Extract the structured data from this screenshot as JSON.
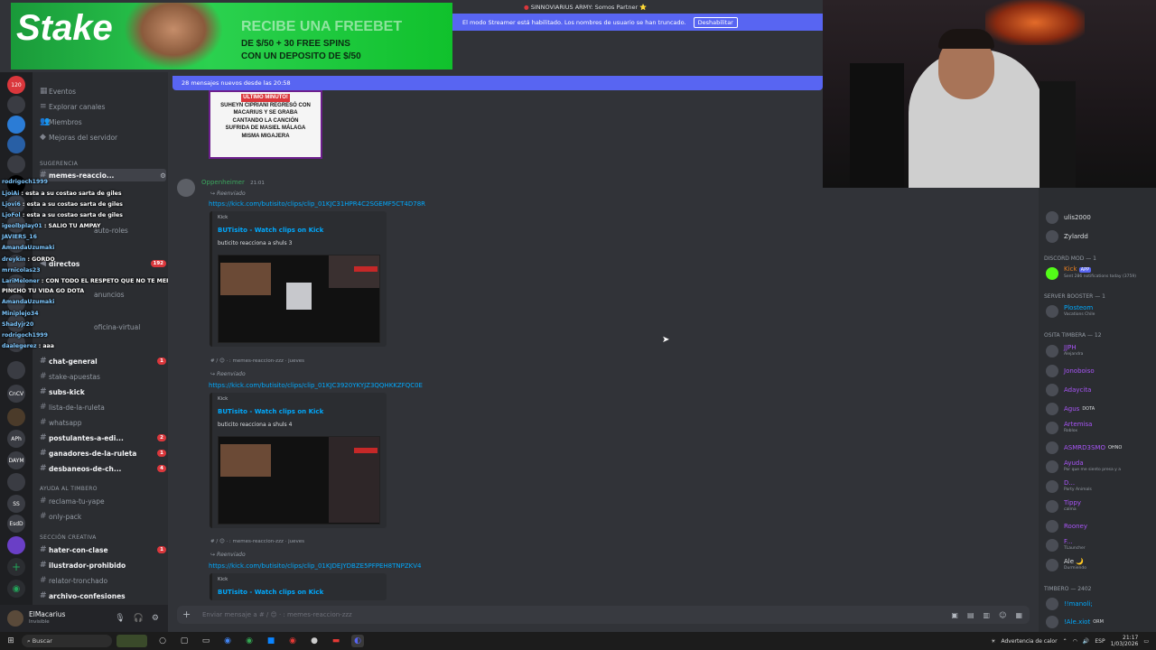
{
  "ad": {
    "logo": "Stake",
    "line1": "RECIBE UNA FREEBET",
    "line2": "DE $/50 + 30 FREE SPINS",
    "line3": "CON UN DEPOSITO DE $/50"
  },
  "top_title": "SINNOVIARIUS ARMY: Somos Partner ⭐",
  "streamer_banner": {
    "text": "El modo Streamer está habilitado. Los nombres de usuario se han truncado.",
    "button": "Deshabilitar"
  },
  "new_messages": "28 mensajes nuevos desde las 20:58",
  "sidebar": {
    "nav": [
      {
        "label": "Eventos"
      },
      {
        "label": "Explorar canales"
      },
      {
        "label": "Miembros"
      },
      {
        "label": "Mejoras del servidor"
      }
    ],
    "cat_sugerencia": "Sugerencia",
    "channels": [
      {
        "label": "memes-reaccio...",
        "unread": true
      },
      {
        "label": "directos",
        "unread": true,
        "badge": "192"
      },
      {
        "label": "auto-roles",
        "unread": false
      },
      {
        "label": "anuncios",
        "unread": false
      },
      {
        "label": "oficina-virtual",
        "unread": false
      },
      {
        "label": "chat-general",
        "unread": true,
        "badge": "1"
      },
      {
        "label": "stake-apuestas",
        "unread": false
      },
      {
        "label": "subs-kick",
        "unread": true
      },
      {
        "label": "lista-de-la-ruleta",
        "unread": false
      },
      {
        "label": "whatsapp",
        "unread": false
      },
      {
        "label": "postulantes-a-edi...",
        "unread": true,
        "badge": "2"
      },
      {
        "label": "ganadores-de-la-ruleta",
        "unread": true,
        "badge": "1"
      },
      {
        "label": "desbaneos-de-ch...",
        "unread": true,
        "badge": "4"
      },
      {
        "label": "reclama-tu-yape",
        "unread": false
      },
      {
        "label": "only-pack",
        "unread": false
      },
      {
        "label": "hater-con-clase",
        "unread": true,
        "badge": "1"
      },
      {
        "label": "ilustrador-prohibido",
        "unread": true
      },
      {
        "label": "relator-tronchado",
        "unread": false
      },
      {
        "label": "archivo-confesiones",
        "unread": true
      }
    ],
    "cat_ayuda": "AYUDA AL TIMBERO",
    "cat_creativa": "SECCIÓN CREATIVA"
  },
  "user": {
    "name": "ElMacarius",
    "status": "Invisible"
  },
  "image_caption": [
    "ÚLTIMO MINUTO!",
    "SUHEYN CIPRIANI REGRESÓ CON",
    "MACARIUS Y SE GRABA",
    "CANTANDO LA CANCIÓN",
    "SUFRIDA DE MASIEL MÁLAGA",
    "MISMA MIGAJERA"
  ],
  "message": {
    "author": "Oppenheimer",
    "time": "21:01"
  },
  "forwards": [
    {
      "label": "Reenviado",
      "url": "https://kick.com/butisito/clips/clip_01KJC31HPR4C2SGEMF5CT4D78R",
      "provider": "Kick",
      "title": "BUTisito - Watch clips on Kick",
      "desc": "buticito reacciona a shuls 3",
      "footer": "memes-reaccion-zzz · jueves"
    },
    {
      "label": "Reenviado",
      "url": "https://kick.com/butisito/clips/clip_01KJC3920YKYJZ3QQHKKZFQC0E",
      "provider": "Kick",
      "title": "BUTisito - Watch clips on Kick",
      "desc": "buticito reacciona a shuls 4",
      "footer": "memes-reaccion-zzz · jueves"
    },
    {
      "label": "Reenviado",
      "url": "https://kick.com/butisito/clips/clip_01KJDEJYDBZE5PFPEH8TNPZKV4",
      "provider": "Kick",
      "title": "BUTisito - Watch clips on Kick"
    }
  ],
  "composer_placeholder": "Enviar mensaje a # / 😊 · : memes-reaccion-zzz",
  "members": {
    "top": [
      {
        "name": "ulis2000"
      },
      {
        "name": "Zylardd"
      }
    ],
    "cat_mod": "DISCORD MOD — 1",
    "mod": {
      "name": "Kick",
      "tag": "APP",
      "sub": "Sent 286 notifications today (3759)"
    },
    "cat_booster": "SERVER BOOSTER — 1",
    "booster": {
      "name": "Plosteom",
      "sub": "Vacations Chile"
    },
    "cat_timbera": "OSITA TIMBERA — 12",
    "timbera": [
      {
        "name": "JJPH",
        "sub": "Alejandra"
      },
      {
        "name": "Jonoboiso",
        "sub": ""
      },
      {
        "name": "Adaycita",
        "sub": ""
      },
      {
        "name": "Agus",
        "sub": "DOTA"
      },
      {
        "name": "Artemisa",
        "sub": "Roblox"
      },
      {
        "name": "ASMRD3SMO",
        "sub": "OHNO"
      },
      {
        "name": "Ayuda",
        "sub": "Por que me siento presa y a"
      },
      {
        "name": "D...",
        "sub": "Party Animals"
      },
      {
        "name": "Tippy",
        "sub": "calma"
      },
      {
        "name": "Rooney",
        "sub": ""
      },
      {
        "name": "F...",
        "sub": "TLauncher"
      },
      {
        "name": "Ale 🌙",
        "sub": "Durmiendo"
      }
    ],
    "cat_timbero": "TIMBERO — 2402",
    "timbero": [
      {
        "name": "!!manoli;",
        "sub": ""
      },
      {
        "name": "!Ale.xiot",
        "sub": "ORM"
      }
    ]
  },
  "stream_chat": [
    {
      "user": "rodrigoch1999",
      "msg": ""
    },
    {
      "user": "LjoiAi",
      "msg": "esta a su costao sarta de giles"
    },
    {
      "user": "Ljovi6",
      "msg": "esta a su costao sarta de giles"
    },
    {
      "user": "LjoFol",
      "msg": "esta a su costao sarta de giles"
    },
    {
      "user": "igeolbplay01",
      "msg": "SALIO TU AMPAY"
    },
    {
      "user": "JAVIERS_16",
      "msg": ""
    },
    {
      "user": "AmandaUzumaki",
      "msg": ""
    },
    {
      "user": "dreykin",
      "msg": "GORDO"
    },
    {
      "user": "mrnicolas23",
      "msg": ""
    },
    {
      "user": "LariMeloner",
      "msg": "CON TODO EL RESPETO QUE NO TE MERECES ME LLEGA AL"
    },
    {
      "user": "",
      "msg": "PINCHO TU VIDA GO DOTA"
    },
    {
      "user": "AmandaUzumaki",
      "msg": ""
    },
    {
      "user": "Miniplejo34",
      "msg": ""
    },
    {
      "user": "Shadyjr20",
      "msg": ""
    },
    {
      "user": "rodrigoch1999",
      "msg": ""
    },
    {
      "user": "daalegerez",
      "msg": "aaa"
    }
  ],
  "taskbar": {
    "search": "Buscar",
    "weather": "Advertencia de calor",
    "lang": "ESP",
    "time": "21:17",
    "date": "1/03/2026"
  }
}
